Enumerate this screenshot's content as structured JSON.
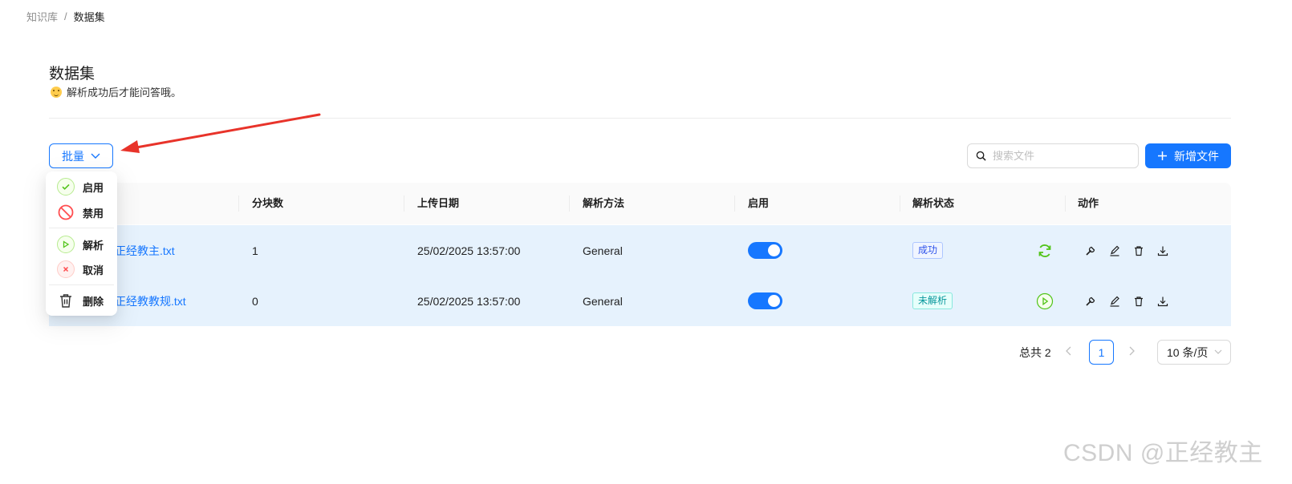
{
  "breadcrumb": {
    "parent": "知识库",
    "separator": "/",
    "current": "数据集"
  },
  "page": {
    "title": "数据集",
    "subtitle": "解析成功后才能问答哦。"
  },
  "toolbar": {
    "batch_label": "批量",
    "search_placeholder": "搜索文件",
    "add_label": "新增文件"
  },
  "dropdown": {
    "items": [
      {
        "label": "启用",
        "icon": "check-circle-icon"
      },
      {
        "label": "禁用",
        "icon": "stop-icon"
      },
      {
        "label": "解析",
        "icon": "play-circle-icon"
      },
      {
        "label": "取消",
        "icon": "close-circle-icon"
      },
      {
        "label": "删除",
        "icon": "trash-icon"
      }
    ]
  },
  "table": {
    "columns": [
      "分块数",
      "上传日期",
      "解析方法",
      "启用",
      "解析状态",
      "动作"
    ],
    "rows": [
      {
        "name": "正经教主.txt",
        "chunks": "1",
        "date": "25/02/2025 13:57:00",
        "method": "General",
        "enabled": true,
        "status": "成功",
        "status_icon": "refresh-icon"
      },
      {
        "name": "正经教教规.txt",
        "chunks": "0",
        "date": "25/02/2025 13:57:00",
        "method": "General",
        "enabled": true,
        "status": "未解析",
        "status_icon": "play-circle-icon"
      }
    ]
  },
  "pagination": {
    "total": "总共 2",
    "current": "1",
    "page_size": "10 条/页"
  },
  "watermark": "CSDN @正经教主",
  "colors": {
    "primary": "#1677ff",
    "row_bg": "#e6f2fd",
    "success": "#52c41a",
    "danger": "#ff4d4f",
    "annotation_arrow": "#e8332a"
  }
}
